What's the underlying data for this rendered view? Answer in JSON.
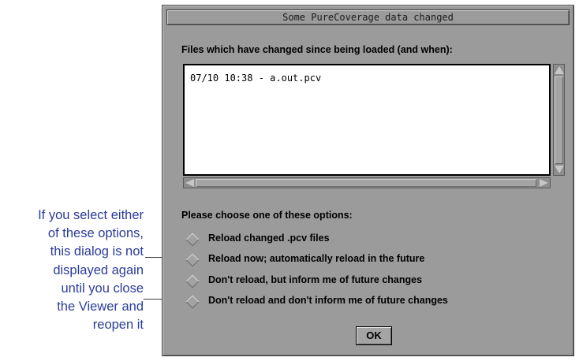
{
  "callout": {
    "lines": [
      "If you select either",
      "of these options,",
      "this dialog is not",
      "displayed again",
      "until you close",
      "the Viewer and",
      "reopen it"
    ]
  },
  "dialog": {
    "title": "Some PureCoverage data changed",
    "files_label": "Files which have changed since being loaded (and when):",
    "files": [
      "07/10 10:38 - a.out.pcv"
    ],
    "options_label": "Please choose one of these options:",
    "options": [
      {
        "label": "Reload changed .pcv files"
      },
      {
        "label": "Reload now; automatically reload in the future"
      },
      {
        "label": "Don't reload, but inform me of future changes"
      },
      {
        "label": "Don't reload and don't inform me of future changes"
      }
    ],
    "ok_label": "OK"
  },
  "colors": {
    "dialog_background": "#9b9b9b",
    "callout_text": "#2b3c9a"
  },
  "icons": {
    "scroll_up": "arrow-up-icon",
    "scroll_down": "arrow-down-icon",
    "scroll_left": "arrow-left-icon",
    "scroll_right": "arrow-right-icon",
    "radio": "diamond-radio-icon"
  }
}
